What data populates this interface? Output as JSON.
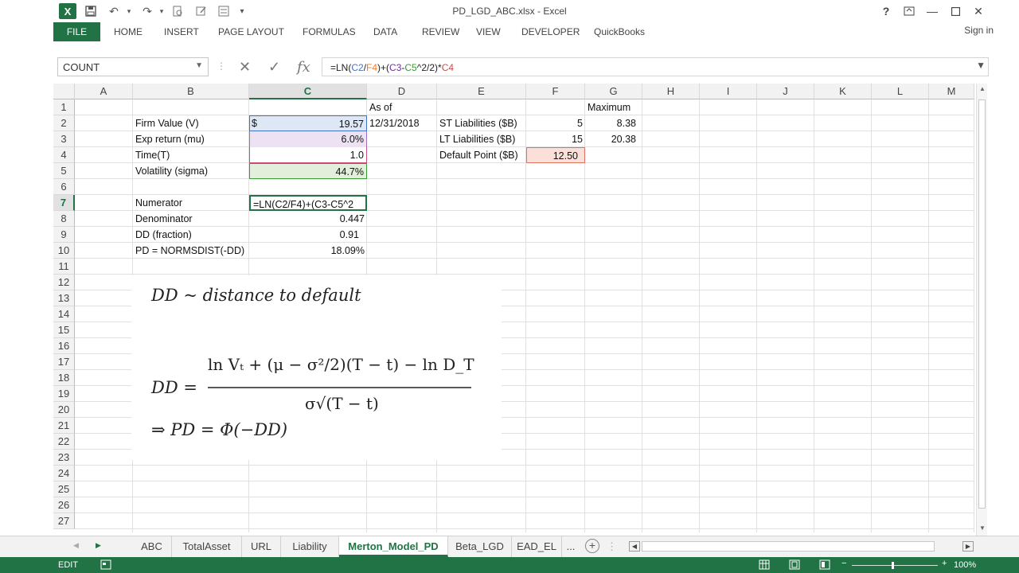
{
  "window": {
    "title": "PD_LGD_ABC.xlsx - Excel",
    "help": "?",
    "min": "—",
    "max": "☐",
    "close": "✕"
  },
  "qat": {
    "excel_logo": "X",
    "save": "💾",
    "undo": "↶",
    "redo": "↷",
    "more": "▾"
  },
  "ribbon": {
    "file": "FILE",
    "tabs": [
      "HOME",
      "INSERT",
      "PAGE LAYOUT",
      "FORMULAS",
      "DATA",
      "REVIEW",
      "VIEW",
      "DEVELOPER",
      "QuickBooks"
    ],
    "sign_in": "Sign in"
  },
  "formula_bar": {
    "name_box": "COUNT",
    "cancel": "✕",
    "enter": "✓",
    "fx": "fx",
    "formula_parts": [
      {
        "t": "=LN(",
        "c": ""
      },
      {
        "t": "C2",
        "c": "ref-blue"
      },
      {
        "t": "/",
        "c": ""
      },
      {
        "t": "F4",
        "c": "ref-orange"
      },
      {
        "t": ")+(",
        "c": ""
      },
      {
        "t": "C3",
        "c": "ref-purple"
      },
      {
        "t": "-",
        "c": ""
      },
      {
        "t": "C5",
        "c": "ref-green"
      },
      {
        "t": "^2/2)*",
        "c": ""
      },
      {
        "t": "C4",
        "c": "ref-red"
      }
    ]
  },
  "columns": [
    "A",
    "B",
    "C",
    "D",
    "E",
    "F",
    "G",
    "H",
    "I",
    "J",
    "K",
    "L",
    "M"
  ],
  "rows": [
    "1",
    "2",
    "3",
    "4",
    "5",
    "6",
    "7",
    "8",
    "9",
    "10",
    "11",
    "12",
    "13",
    "14",
    "15",
    "16",
    "17",
    "18",
    "19",
    "20",
    "21",
    "22",
    "23",
    "24",
    "25",
    "26",
    "27"
  ],
  "cells": {
    "B2": "Firm Value (V)",
    "B3": "Exp return (mu)",
    "B4": "Time(T)",
    "B5": "Volatility (sigma)",
    "B7": "Numerator",
    "B8": "Denominator",
    "B9": "DD (fraction)",
    "B10": "PD = NORMSDIST(-DD)",
    "C2_cur": "$",
    "C2": "19.57",
    "C3": "6.0%",
    "C4": "1.0",
    "C5": "44.7%",
    "C7": "=LN(C2/F4)+(C3-C5^2",
    "C8": "0.447",
    "C9": "0.91",
    "C10": "18.09%",
    "D1": "As of",
    "D2": "12/31/2018",
    "E2": "ST Liabilities ($B)",
    "E3": "LT Liabilities ($B)",
    "E4": "Default Point ($B)",
    "F2": "5",
    "F3": "15",
    "F4": "12.50",
    "G1": "Maximum",
    "G2": "8.38",
    "G3": "20.38"
  },
  "formula_image": {
    "line1": "DD ~ distance to default",
    "lhs": "DD =",
    "numerator": "ln Vₜ + (μ − σ²/2)(T − t) − ln D_T",
    "denominator": "σ√(T − t)",
    "line3": "⇒ PD = Φ(−DD)"
  },
  "sheets": [
    "ABC",
    "TotalAsset",
    "URL",
    "Liability",
    "Merton_Model_PD",
    "Beta_LGD",
    "EAD_EL",
    "..."
  ],
  "active_sheet": "Merton_Model_PD",
  "status": {
    "mode": "EDIT",
    "zoom": "100%"
  }
}
